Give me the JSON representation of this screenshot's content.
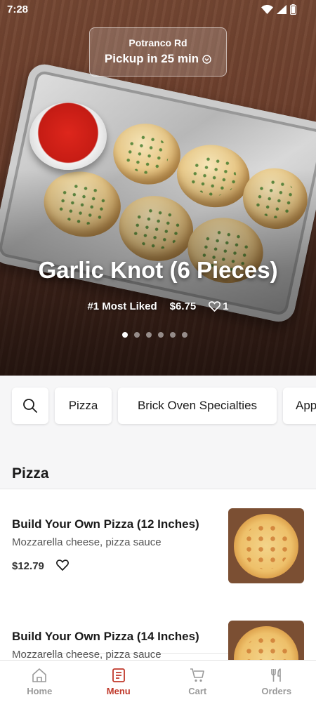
{
  "status_bar": {
    "time": "7:28"
  },
  "pickup": {
    "location": "Potranco Rd",
    "time_label": "Pickup in 25 min"
  },
  "hero": {
    "title": "Garlic Knot (6 Pieces)",
    "badge": "#1 Most Liked",
    "price": "$6.75",
    "likes": "1",
    "carousel_count": 6,
    "carousel_active_index": 0
  },
  "categories": {
    "chips": [
      "Pizza",
      "Brick Oven Specialties",
      "Appetizers"
    ]
  },
  "menu": {
    "section_title": "Pizza",
    "items": [
      {
        "name": "Build Your Own Pizza (12 Inches)",
        "description": "Mozzarella cheese, pizza sauce",
        "price": "$12.79"
      },
      {
        "name": "Build Your Own Pizza (14 Inches)",
        "description": "Mozzarella cheese, pizza sauce",
        "price": ""
      }
    ]
  },
  "nav": {
    "tabs": [
      {
        "label": "Home",
        "icon": "home-icon",
        "active": false
      },
      {
        "label": "Menu",
        "icon": "menu-icon",
        "active": true
      },
      {
        "label": "Cart",
        "icon": "cart-icon",
        "active": false
      },
      {
        "label": "Orders",
        "icon": "orders-icon",
        "active": false
      }
    ]
  },
  "colors": {
    "accent": "#c0392b",
    "inactive": "#9a9a9a"
  }
}
